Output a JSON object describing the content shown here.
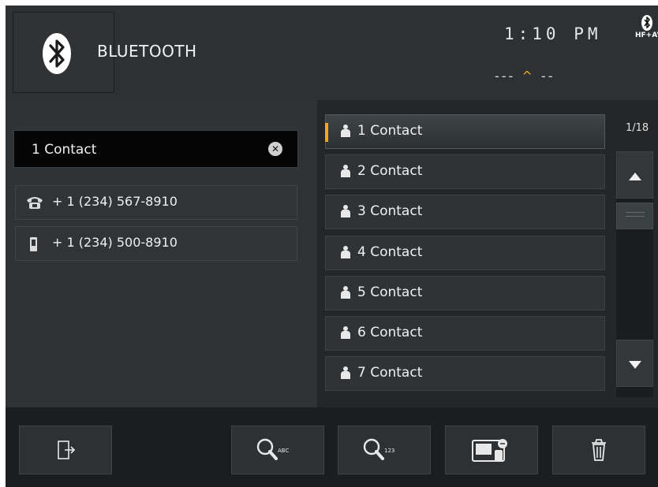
{
  "header": {
    "title": "BLUETOOTH",
    "clock": "1:10 PM",
    "bt_status_label": "HF+AV",
    "signal_left": "---",
    "signal_caret": "^",
    "signal_right": "--"
  },
  "search": {
    "value": "1 Contact",
    "clear_icon": "close-circle-icon"
  },
  "phones": [
    {
      "icon": "landline-phone-icon",
      "number": "+ 1 (234) 567-8910"
    },
    {
      "icon": "mobile-phone-icon",
      "number": "+ 1 (234) 500-8910"
    }
  ],
  "contacts": [
    {
      "name": "1 Contact",
      "active": true
    },
    {
      "name": "2 Contact"
    },
    {
      "name": "3 Contact"
    },
    {
      "name": "4 Contact"
    },
    {
      "name": "5 Contact"
    },
    {
      "name": "6 Contact"
    },
    {
      "name": "7 Contact"
    }
  ],
  "pagination": {
    "page_indicator": "1/18"
  },
  "colors": {
    "accent": "#f5a623",
    "background": "#2b2e30",
    "footer": "#1b1d1e"
  },
  "footer": {
    "buttons": [
      "exit-icon",
      "search-abc-icon",
      "search-123-icon",
      "device-sync-icon",
      "trash-icon"
    ],
    "search_abc_label": "ABC",
    "search_123_label": "123"
  }
}
